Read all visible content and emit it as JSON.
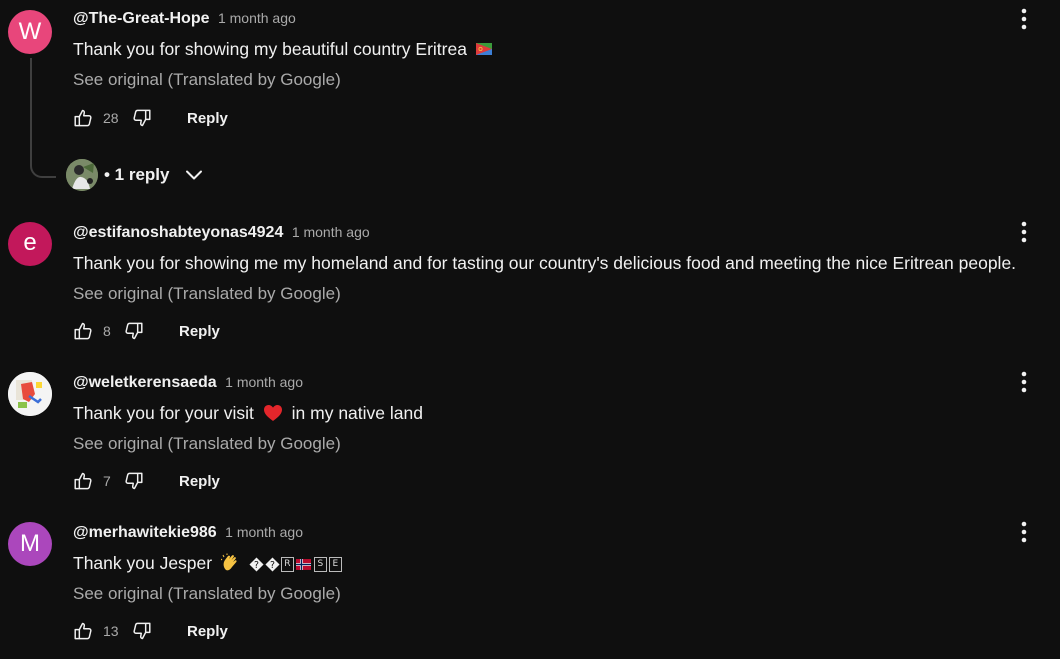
{
  "colors": {
    "background": "#0f0f0f",
    "text_primary": "#f1f1f1",
    "text_secondary": "#aaaaaa",
    "thread_line": "#3f3f3f"
  },
  "comments": [
    {
      "avatar_letter": "W",
      "avatar_color": "#e8467b",
      "author": "@The-Great-Hope",
      "time": "1 month ago",
      "text": "Thank you for showing my beautiful country Eritrea",
      "text_emoji": "eritrea-flag",
      "see_original": "See original (Translated by Google)",
      "likes": "28",
      "reply_label": "Reply",
      "replies_label": "• 1 reply"
    },
    {
      "avatar_letter": "e",
      "avatar_color": "#c2185b",
      "author": "@estifanoshabteyonas4924",
      "time": "1 month ago",
      "text": "Thank you for showing me my homeland and for tasting our country's delicious food and meeting the nice Eritrean people.",
      "see_original": "See original (Translated by Google)",
      "likes": "8",
      "reply_label": "Reply"
    },
    {
      "avatar_letter": "",
      "avatar_color": "#ffffff",
      "author": "@weletkerensaeda",
      "time": "1 month ago",
      "text_before": "Thank you for your visit",
      "text_emoji": "red-heart",
      "text_after": "in my native land",
      "see_original": "See original (Translated by Google)",
      "likes": "7",
      "reply_label": "Reply"
    },
    {
      "avatar_letter": "M",
      "avatar_color": "#ab47bc",
      "author": "@merhawitekie986",
      "time": "1 month ago",
      "text": "Thank you Jesper",
      "text_emoji": "clapping-hands",
      "tail_chars": [
        "R",
        "S",
        "E"
      ],
      "see_original": "See original (Translated by Google)",
      "likes": "13",
      "reply_label": "Reply"
    }
  ]
}
